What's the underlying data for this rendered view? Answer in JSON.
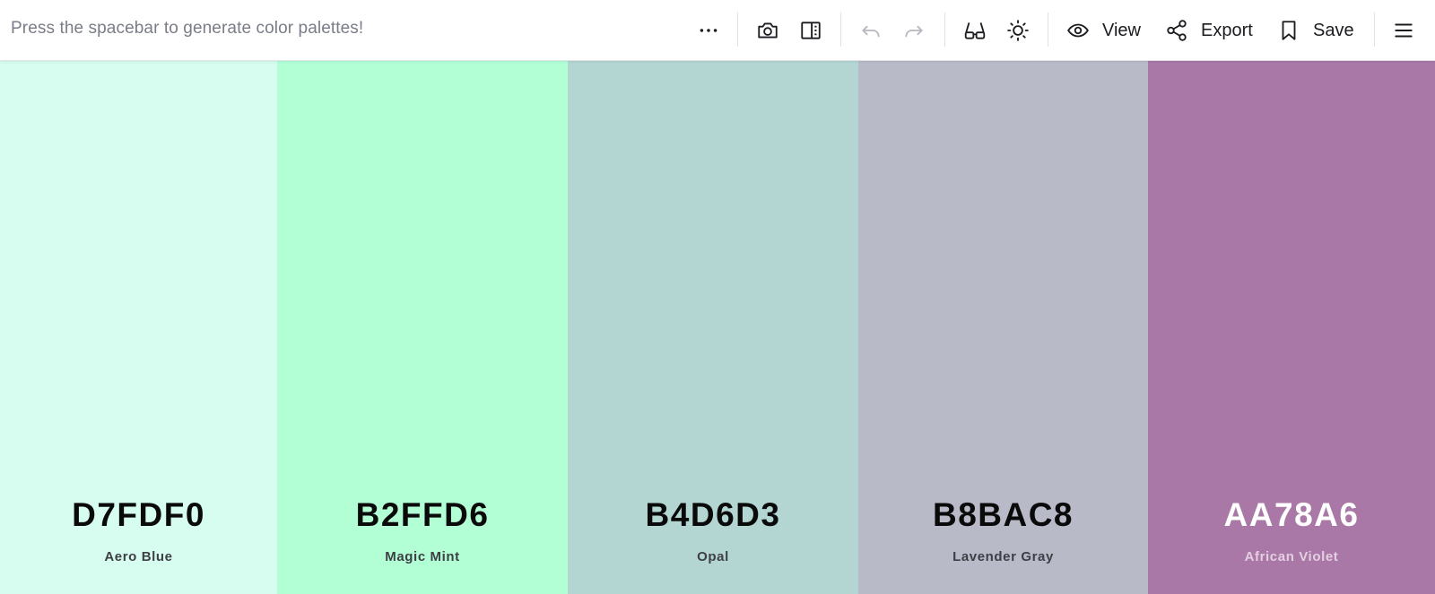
{
  "toolbar": {
    "hint": "Press the spacebar to generate color palettes!",
    "view_label": "View",
    "export_label": "Export",
    "save_label": "Save"
  },
  "icons": {
    "more": "more-horizontal-icon",
    "camera": "camera-icon",
    "panel": "side-panel-icon",
    "undo": "undo-icon",
    "redo": "redo-icon",
    "glasses": "glasses-icon",
    "sun": "sun-icon",
    "eye": "eye-icon",
    "share": "share-icon",
    "bookmark": "bookmark-icon",
    "menu": "hamburger-menu-icon"
  },
  "palette": {
    "colors": [
      {
        "hex": "D7FDF0",
        "name": "Aero Blue",
        "bg": "#D7FDF0",
        "text_color": "#0a0a0a",
        "name_color": "#3d3f45"
      },
      {
        "hex": "B2FFD6",
        "name": "Magic Mint",
        "bg": "#B2FFD6",
        "text_color": "#0a0a0a",
        "name_color": "#3d3f45"
      },
      {
        "hex": "B4D6D3",
        "name": "Opal",
        "bg": "#B4D6D3",
        "text_color": "#0a0a0a",
        "name_color": "#3d3f45"
      },
      {
        "hex": "B8BAC8",
        "name": "Lavender Gray",
        "bg": "#B8BAC8",
        "text_color": "#0a0a0a",
        "name_color": "#3d3f45"
      },
      {
        "hex": "AA78A6",
        "name": "African Violet",
        "bg": "#AA78A6",
        "text_color": "#ffffff",
        "name_color": "#e3cfe1"
      }
    ]
  }
}
